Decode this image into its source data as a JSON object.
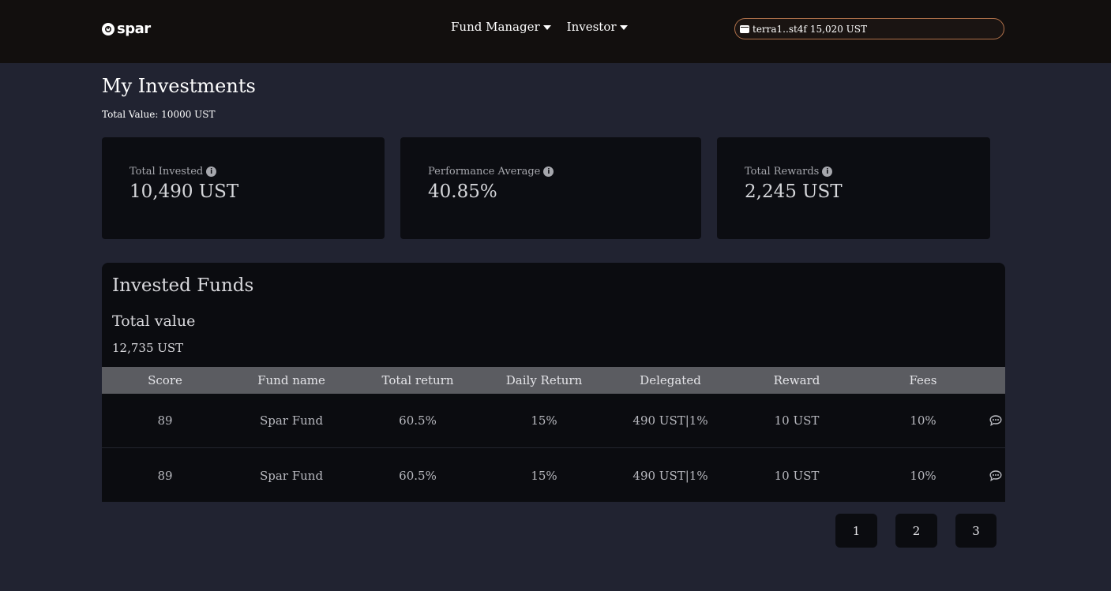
{
  "header": {
    "logo_text": "spar",
    "nav": [
      {
        "label": "Fund Manager"
      },
      {
        "label": "Investor"
      }
    ],
    "wallet": {
      "address": "terra1..st4f",
      "balance": "15,020 UST",
      "icon": "wallet-icon"
    }
  },
  "page": {
    "title": "My Investments",
    "total_value": "Total Value: 10000 UST"
  },
  "stats": [
    {
      "label": "Total Invested",
      "value": "10,490 UST",
      "icon": "info-icon"
    },
    {
      "label": "Performance Average",
      "value": "40.85%",
      "icon": "info-icon"
    },
    {
      "label": "Total Rewards",
      "value": "2,245 UST",
      "icon": "info-icon"
    }
  ],
  "funds": {
    "title": "Invested Funds",
    "subtitle": "Total value",
    "total": "12,735 UST",
    "columns": [
      "Score",
      "Fund name",
      "Total return",
      "Daily Return",
      "Delegated",
      "Reward",
      "Fees"
    ],
    "rows": [
      {
        "score": "89",
        "name": "Spar Fund",
        "total_return": "60.5%",
        "daily_return": "15%",
        "delegated": "490 UST|1%",
        "reward": "10 UST",
        "fees": "10%",
        "action_icon": "chat-icon"
      },
      {
        "score": "89",
        "name": "Spar Fund",
        "total_return": "60.5%",
        "daily_return": "15%",
        "delegated": "490 UST|1%",
        "reward": "10 UST",
        "fees": "10%",
        "action_icon": "chat-icon"
      }
    ]
  },
  "pagination": [
    "1",
    "2",
    "3"
  ],
  "colors": {
    "background": "#212331",
    "header": "#120f0e",
    "card": "#0c0d12",
    "table_header": "#5b5c61",
    "wallet_border": "#b0714a"
  }
}
